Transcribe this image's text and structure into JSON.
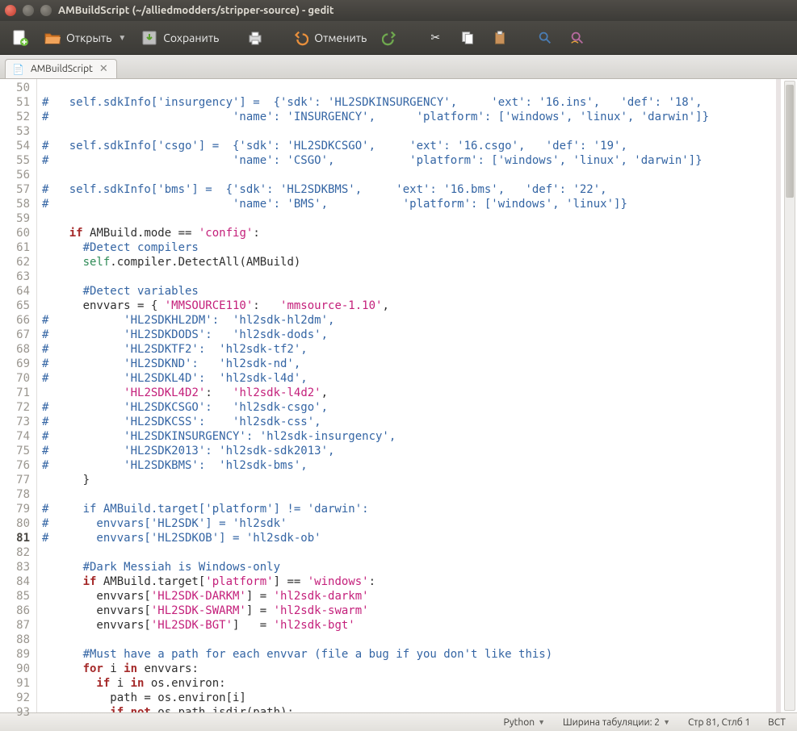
{
  "window": {
    "title": "AMBuildScript (~/alliedmodders/stripper-source) - gedit"
  },
  "toolbar": {
    "open_label": "Открыть",
    "save_label": "Сохранить",
    "undo_label": "Отменить"
  },
  "tab": {
    "icon": "📄",
    "label": "AMBuildScript"
  },
  "editor": {
    "first_line_no": 50,
    "current_line_no": 81,
    "lines": [
      {
        "n": 50,
        "t": ""
      },
      {
        "n": 51,
        "t": "comment",
        "s": "#   self.sdkInfo['insurgency'] =  {'sdk': 'HL2SDKINSURGENCY',     'ext': '16.ins',   'def': '18',"
      },
      {
        "n": 52,
        "t": "comment",
        "s": "#                           'name': 'INSURGENCY',      'platform': ['windows', 'linux', 'darwin']}"
      },
      {
        "n": 53,
        "t": ""
      },
      {
        "n": 54,
        "t": "comment",
        "s": "#   self.sdkInfo['csgo'] =  {'sdk': 'HL2SDKCSGO',     'ext': '16.csgo',   'def': '19',"
      },
      {
        "n": 55,
        "t": "comment",
        "s": "#                           'name': 'CSGO',           'platform': ['windows', 'linux', 'darwin']}"
      },
      {
        "n": 56,
        "t": ""
      },
      {
        "n": 57,
        "t": "comment",
        "s": "#   self.sdkInfo['bms'] =  {'sdk': 'HL2SDKBMS',     'ext': '16.bms',   'def': '22',"
      },
      {
        "n": 58,
        "t": "comment",
        "s": "#                           'name': 'BMS',           'platform': ['windows', 'linux']}"
      },
      {
        "n": 59,
        "t": ""
      },
      {
        "n": 60,
        "tokens": [
          [
            "kw",
            "    if "
          ],
          [
            "id",
            "AMBuild.mode == "
          ],
          [
            "str",
            "'config'"
          ],
          [
            "id",
            ":"
          ]
        ]
      },
      {
        "n": 61,
        "tokens": [
          [
            "cm",
            "      #Detect compilers"
          ]
        ]
      },
      {
        "n": 62,
        "tokens": [
          [
            "id",
            "      "
          ],
          [
            "self",
            "self"
          ],
          [
            "id",
            ".compiler.DetectAll(AMBuild)"
          ]
        ]
      },
      {
        "n": 63,
        "t": ""
      },
      {
        "n": 64,
        "tokens": [
          [
            "cm",
            "      #Detect variables"
          ]
        ]
      },
      {
        "n": 65,
        "tokens": [
          [
            "id",
            "      envvars = { "
          ],
          [
            "str",
            "'MMSOURCE110'"
          ],
          [
            "id",
            ":   "
          ],
          [
            "str",
            "'mmsource-1.10'"
          ],
          [
            "id",
            ","
          ]
        ]
      },
      {
        "n": 66,
        "t": "comment",
        "s": "#           'HL2SDKHL2DM':  'hl2sdk-hl2dm',"
      },
      {
        "n": 67,
        "t": "comment",
        "s": "#           'HL2SDKDODS':   'hl2sdk-dods',"
      },
      {
        "n": 68,
        "t": "comment",
        "s": "#           'HL2SDKTF2':  'hl2sdk-tf2',"
      },
      {
        "n": 69,
        "t": "comment",
        "s": "#           'HL2SDKND':   'hl2sdk-nd',"
      },
      {
        "n": 70,
        "t": "comment",
        "s": "#           'HL2SDKL4D':  'hl2sdk-l4d',"
      },
      {
        "n": 71,
        "tokens": [
          [
            "id",
            "            "
          ],
          [
            "str",
            "'HL2SDKL4D2'"
          ],
          [
            "id",
            ":   "
          ],
          [
            "str",
            "'hl2sdk-l4d2'"
          ],
          [
            "id",
            ","
          ]
        ]
      },
      {
        "n": 72,
        "t": "comment",
        "s": "#           'HL2SDKCSGO':   'hl2sdk-csgo',"
      },
      {
        "n": 73,
        "t": "comment",
        "s": "#           'HL2SDKCSS':    'hl2sdk-css',"
      },
      {
        "n": 74,
        "t": "comment",
        "s": "#           'HL2SDKINSURGENCY': 'hl2sdk-insurgency',"
      },
      {
        "n": 75,
        "t": "comment",
        "s": "#           'HL2SDK2013': 'hl2sdk-sdk2013',"
      },
      {
        "n": 76,
        "t": "comment",
        "s": "#           'HL2SDKBMS':  'hl2sdk-bms',"
      },
      {
        "n": 77,
        "tokens": [
          [
            "id",
            "      }"
          ]
        ]
      },
      {
        "n": 78,
        "t": ""
      },
      {
        "n": 79,
        "t": "comment",
        "s": "#     if AMBuild.target['platform'] != 'darwin':"
      },
      {
        "n": 80,
        "t": "comment",
        "s": "#       envvars['HL2SDK'] = 'hl2sdk'"
      },
      {
        "n": 81,
        "t": "comment",
        "s": "#       envvars['HL2SDKOB'] = 'hl2sdk-ob'"
      },
      {
        "n": 82,
        "t": ""
      },
      {
        "n": 83,
        "tokens": [
          [
            "cm",
            "      #Dark Messiah is Windows-only"
          ]
        ]
      },
      {
        "n": 84,
        "tokens": [
          [
            "kw",
            "      if "
          ],
          [
            "id",
            "AMBuild.target["
          ],
          [
            "str",
            "'platform'"
          ],
          [
            "id",
            "] == "
          ],
          [
            "str",
            "'windows'"
          ],
          [
            "id",
            ":"
          ]
        ]
      },
      {
        "n": 85,
        "tokens": [
          [
            "id",
            "        envvars["
          ],
          [
            "str",
            "'HL2SDK-DARKM'"
          ],
          [
            "id",
            "] = "
          ],
          [
            "str",
            "'hl2sdk-darkm'"
          ]
        ]
      },
      {
        "n": 86,
        "tokens": [
          [
            "id",
            "        envvars["
          ],
          [
            "str",
            "'HL2SDK-SWARM'"
          ],
          [
            "id",
            "] = "
          ],
          [
            "str",
            "'hl2sdk-swarm'"
          ]
        ]
      },
      {
        "n": 87,
        "tokens": [
          [
            "id",
            "        envvars["
          ],
          [
            "str",
            "'HL2SDK-BGT'"
          ],
          [
            "id",
            "]   = "
          ],
          [
            "str",
            "'hl2sdk-bgt'"
          ]
        ]
      },
      {
        "n": 88,
        "t": ""
      },
      {
        "n": 89,
        "tokens": [
          [
            "cm",
            "      #Must have a path for each envvar (file a bug if you don't like this)"
          ]
        ]
      },
      {
        "n": 90,
        "tokens": [
          [
            "kw",
            "      for "
          ],
          [
            "id",
            "i "
          ],
          [
            "kw",
            "in "
          ],
          [
            "id",
            "envvars:"
          ]
        ]
      },
      {
        "n": 91,
        "tokens": [
          [
            "kw",
            "        if "
          ],
          [
            "id",
            "i "
          ],
          [
            "kw",
            "in "
          ],
          [
            "id",
            "os.environ:"
          ]
        ]
      },
      {
        "n": 92,
        "tokens": [
          [
            "id",
            "          path = os.environ[i]"
          ]
        ]
      },
      {
        "n": 93,
        "tokens": [
          [
            "kw",
            "          if not "
          ],
          [
            "id",
            "os.path.isdir(path):"
          ]
        ]
      }
    ]
  },
  "statusbar": {
    "language": "Python",
    "tab_width_label": "Ширина табуляции: 2",
    "position": "Стр 81, Стлб 1",
    "insert_mode": "ВСТ"
  }
}
